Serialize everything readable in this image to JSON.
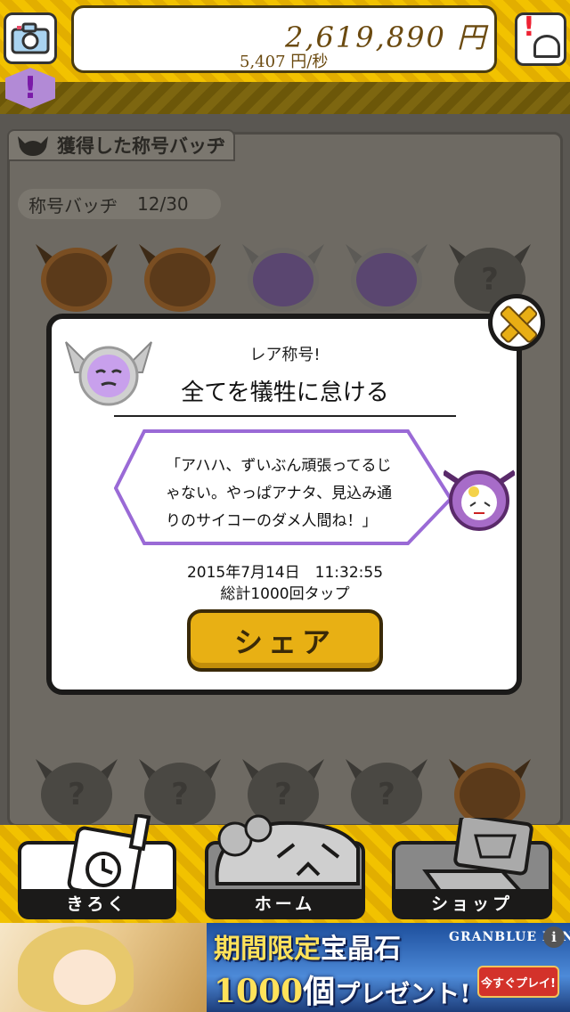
{
  "header": {
    "total_money": "2,619,890 円",
    "money_rate": "5,407 円/秒",
    "alert_badge": "!",
    "notice_mark": "!"
  },
  "panel": {
    "tab_title": "獲得した称号バッヂ",
    "count_label": "称号バッヂ",
    "count_value": "12/30"
  },
  "badges": [
    {
      "state": "bronze"
    },
    {
      "state": "bronze"
    },
    {
      "state": "silver"
    },
    {
      "state": "silver"
    },
    {
      "state": "locked",
      "mark": "?"
    },
    {
      "state": "locked",
      "mark": "?"
    },
    {
      "state": "locked",
      "mark": "?"
    },
    {
      "state": "locked",
      "mark": "?"
    },
    {
      "state": "locked",
      "mark": "?"
    },
    {
      "state": "bronze"
    }
  ],
  "modal": {
    "rare_label": "レア称号!",
    "title": "全てを犠牲に怠ける",
    "quote_line1": "「アハハ、ずいぶん頑張ってるじ",
    "quote_line2": "ゃない。やっぱアナタ、見込み通",
    "quote_line3": "りのサイコーのダメ人間ね！」",
    "date": "2015年7月14日　11:32:55",
    "total_taps": "総計1000回タップ",
    "share_label": "シェア"
  },
  "nav": {
    "record_label": "きろく",
    "home_label": "ホーム",
    "shop_label": "ショップ"
  },
  "ad": {
    "line1_a": "期間限定",
    "line1_b": "宝晶石",
    "line2_a": "1000",
    "line2_b": "個",
    "line2_c": "プレゼント!",
    "logo": "GRANBLUE FANTA",
    "cta": "今すぐプレイ!",
    "info": "i"
  },
  "colors": {
    "accent_yellow": "#f2c200",
    "button_gold": "#e8b014",
    "rare_purple": "#b28ad6"
  }
}
